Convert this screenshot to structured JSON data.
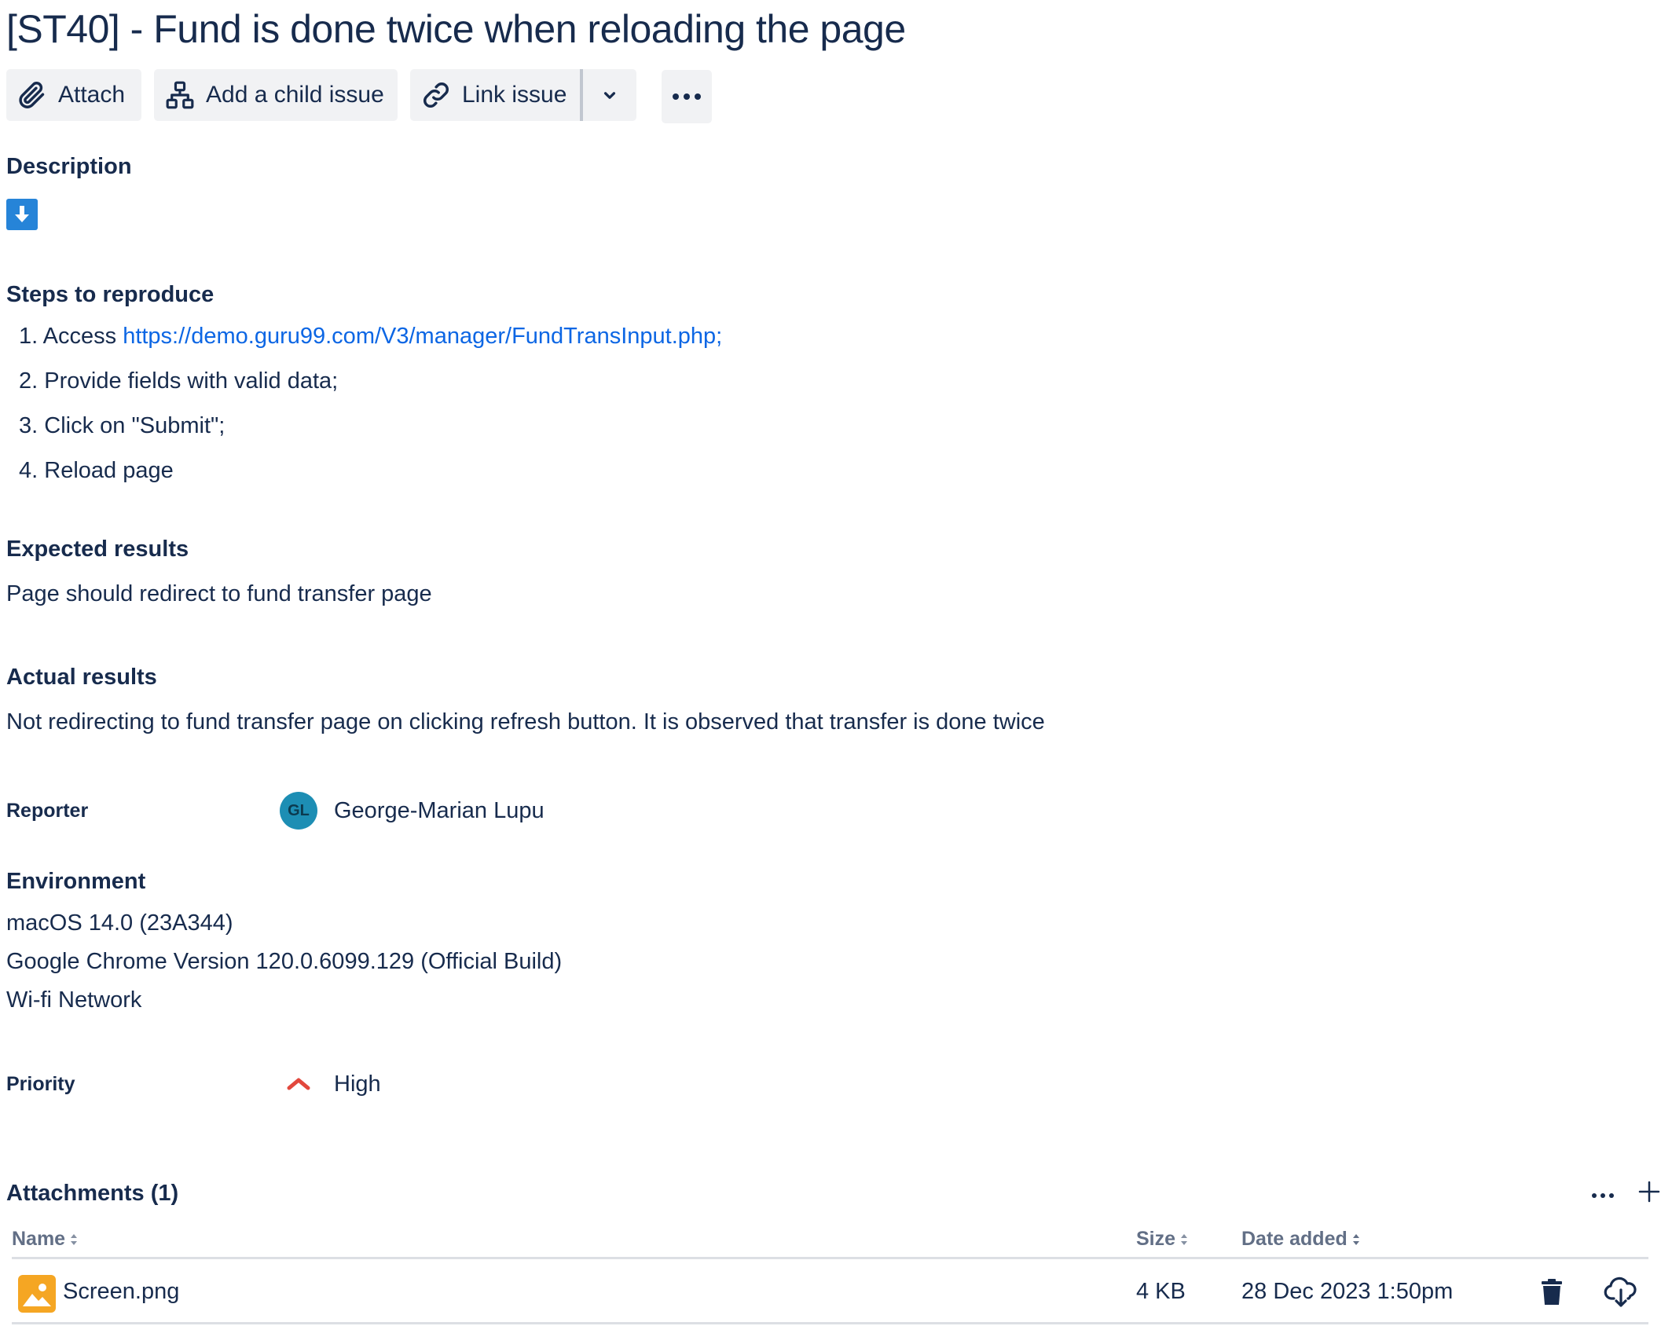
{
  "issue": {
    "title": "[ST40] - Fund is done twice when reloading the page"
  },
  "toolbar": {
    "attach_label": "Attach",
    "child_issue_label": "Add a child issue",
    "link_issue_label": "Link issue"
  },
  "description": {
    "heading": "Description",
    "steps_heading": "Steps to reproduce",
    "steps": [
      {
        "num": "1.",
        "prefix": "Access ",
        "link": "https://demo.guru99.com/V3/manager/FundTransInput.php;"
      },
      {
        "num": "2.",
        "text": "Provide fields with valid data;"
      },
      {
        "num": "3.",
        "text": "Click on \"Submit\";"
      },
      {
        "num": "4.",
        "text": "Reload page"
      }
    ],
    "expected_heading": "Expected results",
    "expected_text": "Page should redirect to fund transfer page",
    "actual_heading": "Actual results",
    "actual_text": "Not redirecting to fund transfer page on clicking refresh button. It is observed that transfer is done twice"
  },
  "reporter": {
    "label": "Reporter",
    "initials": "GL",
    "name": "George-Marian Lupu",
    "avatar_color": "#1d8eb4"
  },
  "environment": {
    "heading": "Environment",
    "lines": [
      "macOS 14.0 (23A344)",
      "Google Chrome Version 120.0.6099.129 (Official Build)",
      "Wi-fi Network"
    ]
  },
  "priority": {
    "label": "Priority",
    "value": "High",
    "icon": "priority-high-icon",
    "color": "#e2483d"
  },
  "attachments": {
    "heading": "Attachments (1)",
    "columns": [
      "Name",
      "Size",
      "Date added"
    ],
    "rows": [
      {
        "name": "Screen.png",
        "size": "4 KB",
        "date": "28 Dec 2023 1:50pm"
      }
    ]
  },
  "colors": {
    "text": "#172b4d",
    "link": "#0c66e4",
    "button_bg": "#f1f2f4",
    "file_icon": "#f5a623"
  }
}
